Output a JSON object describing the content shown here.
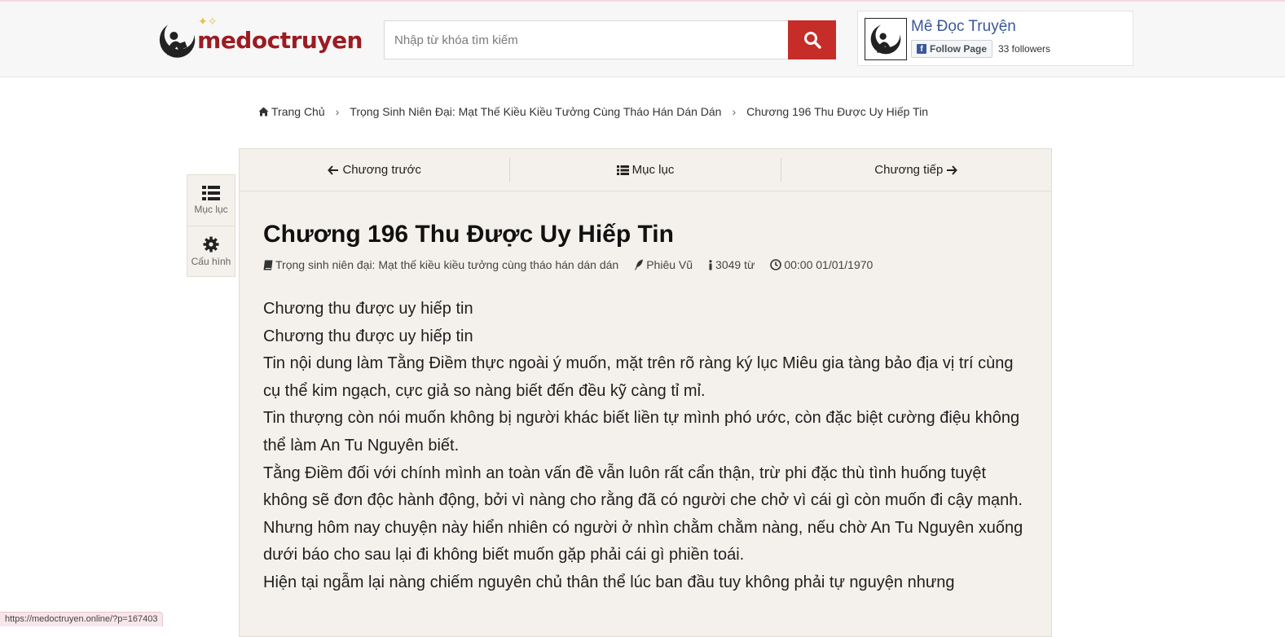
{
  "header": {
    "logo_text": "medoctruyen",
    "search": {
      "placeholder": "Nhập từ khóa tìm kiếm"
    },
    "facebook": {
      "page_name": "Mê Đọc Truyện",
      "follow_label": "Follow Page",
      "followers": "33 followers"
    }
  },
  "breadcrumb": [
    "Trang Chủ",
    "Trọng Sinh Niên Đại: Mạt Thế Kiều Kiều Tưởng Cùng Tháo Hán Dán Dán",
    "Chương 196 Thu Được Uy Hiếp Tin"
  ],
  "sidepanel": {
    "toc_label": "Mục lục",
    "settings_label": "Cấu hình"
  },
  "nav": {
    "prev": "Chương trước",
    "toc": "Mục lục",
    "next": "Chương tiếp"
  },
  "chapter": {
    "title": "Chương 196 Thu Được Uy Hiếp Tin",
    "meta": {
      "book": "Trọng sinh niên đại: Mạt thế kiều kiều tưởng cùng tháo hán dán dán",
      "author": "Phiêu Vũ",
      "words": "3049 từ",
      "time": "00:00 01/01/1970"
    },
    "paragraphs": [
      "Chương thu được uy hiếp tin",
      "Chương thu được uy hiếp tin",
      "Tin nội dung làm Tằng Điềm thực ngoài ý muốn, mặt trên rõ ràng ký lục Miêu gia tàng bảo địa vị trí cùng cụ thể kim ngạch, cực giả so nàng biết đến đều kỹ càng tỉ mỉ.",
      "Tin thượng còn nói muốn không bị người khác biết liền tự mình phó ước, còn đặc biệt cường điệu không thể làm An Tu Nguyên biết.",
      "Tằng Điềm đối với chính mình an toàn vấn đề vẫn luôn rất cẩn thận, trừ phi đặc thù tình huống tuyệt không sẽ đơn độc hành động, bởi vì nàng cho rằng đã có người che chở vì cái gì còn muốn đi cậy mạnh.",
      "Nhưng hôm nay chuyện này hiển nhiên có người ở nhìn chằm chằm nàng, nếu chờ An Tu Nguyên xuống dưới báo cho sau lại đi không biết muốn gặp phải cái gì phiền toái.",
      "Hiện tại ngẫm lại nàng chiếm nguyên chủ thân thể lúc ban đầu tuy không phải tự nguyện nhưng"
    ]
  },
  "status_url": "https://medoctruyen.online/?p=167403"
}
